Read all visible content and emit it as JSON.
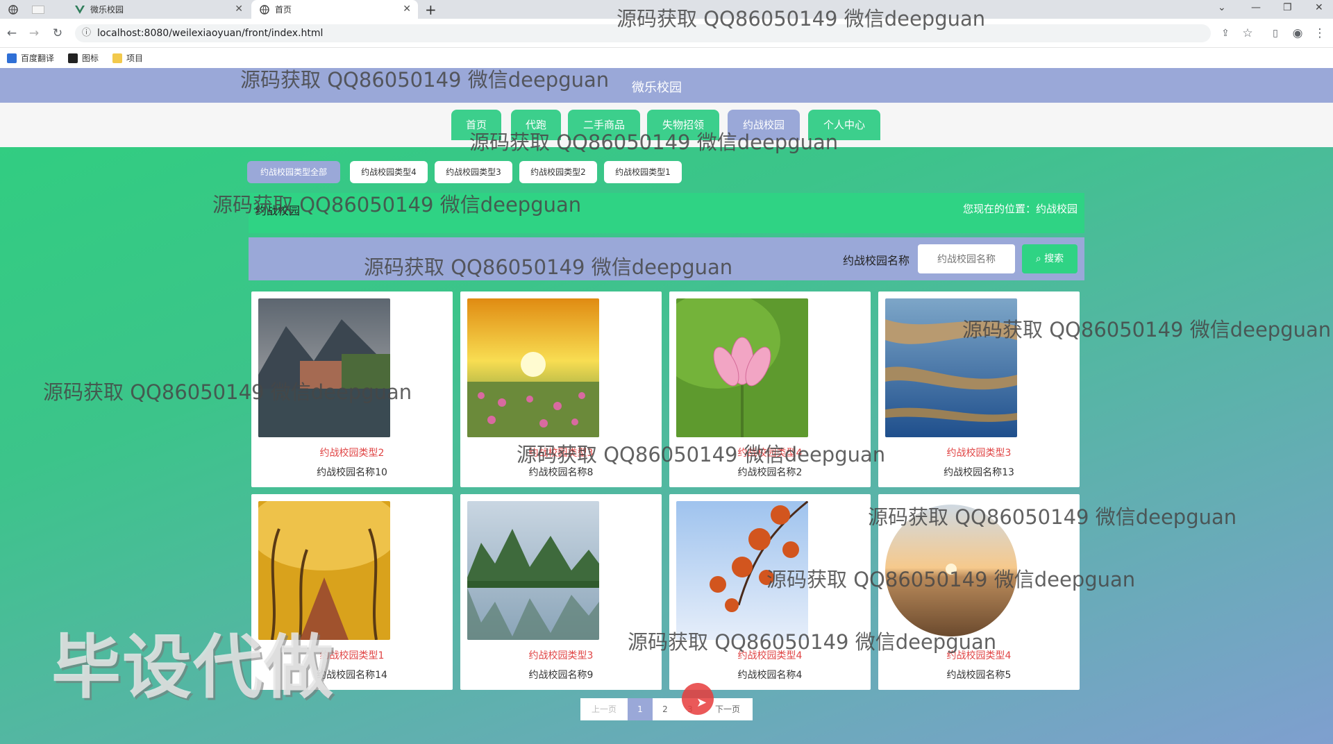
{
  "browser": {
    "tabs": [
      {
        "title": ""
      },
      {
        "title": "微乐校园"
      },
      {
        "title": "首页"
      }
    ],
    "new_tab": "+",
    "url": "localhost:8080/weilexiaoyuan/front/index.html",
    "bookmarks": [
      "百度翻译",
      "图标",
      "项目"
    ]
  },
  "site": {
    "title": "微乐校园",
    "nav": [
      "首页",
      "代跑",
      "二手商品",
      "失物招领",
      "约战校园",
      "个人中心"
    ],
    "nav_active": "约战校园"
  },
  "categories": [
    "约战校园类型全部",
    "约战校园类型4",
    "约战校园类型3",
    "约战校园类型2",
    "约战校园类型1"
  ],
  "breadcrumb": {
    "left": "约战校园",
    "right": "您现在的位置：约战校园"
  },
  "search": {
    "label": "约战校园名称",
    "placeholder": "约战校园名称",
    "button": "搜索"
  },
  "cards": [
    {
      "type": "约战校园类型2",
      "name": "约战校园名称10",
      "scene": "lake-village"
    },
    {
      "type": "约战校园类型3",
      "name": "约战校园名称8",
      "scene": "sunset-field"
    },
    {
      "type": "约战校园类型4",
      "name": "约战校园名称2",
      "scene": "lotus"
    },
    {
      "type": "约战校园类型3",
      "name": "约战校园名称13",
      "scene": "coast"
    },
    {
      "type": "约战校园类型1",
      "name": "约战校园名称14",
      "scene": "autumn-road"
    },
    {
      "type": "约战校园类型3",
      "name": "约战校园名称9",
      "scene": "karst-river"
    },
    {
      "type": "约战校园类型4",
      "name": "约战校园名称4",
      "scene": "red-leaves"
    },
    {
      "type": "约战校园类型4",
      "name": "约战校园名称5",
      "scene": "desert-sunset"
    }
  ],
  "pagination": {
    "prev": "上一页",
    "pages": [
      "1",
      "2",
      "3"
    ],
    "current": "1",
    "next": "下一页"
  },
  "watermark": "源码获取 QQ86050149 微信deepguan",
  "big_watermark": "毕设代做",
  "colors": {
    "header": "#9aa8d8",
    "accent_green": "#2fd384",
    "card_type_red": "#e04545"
  }
}
